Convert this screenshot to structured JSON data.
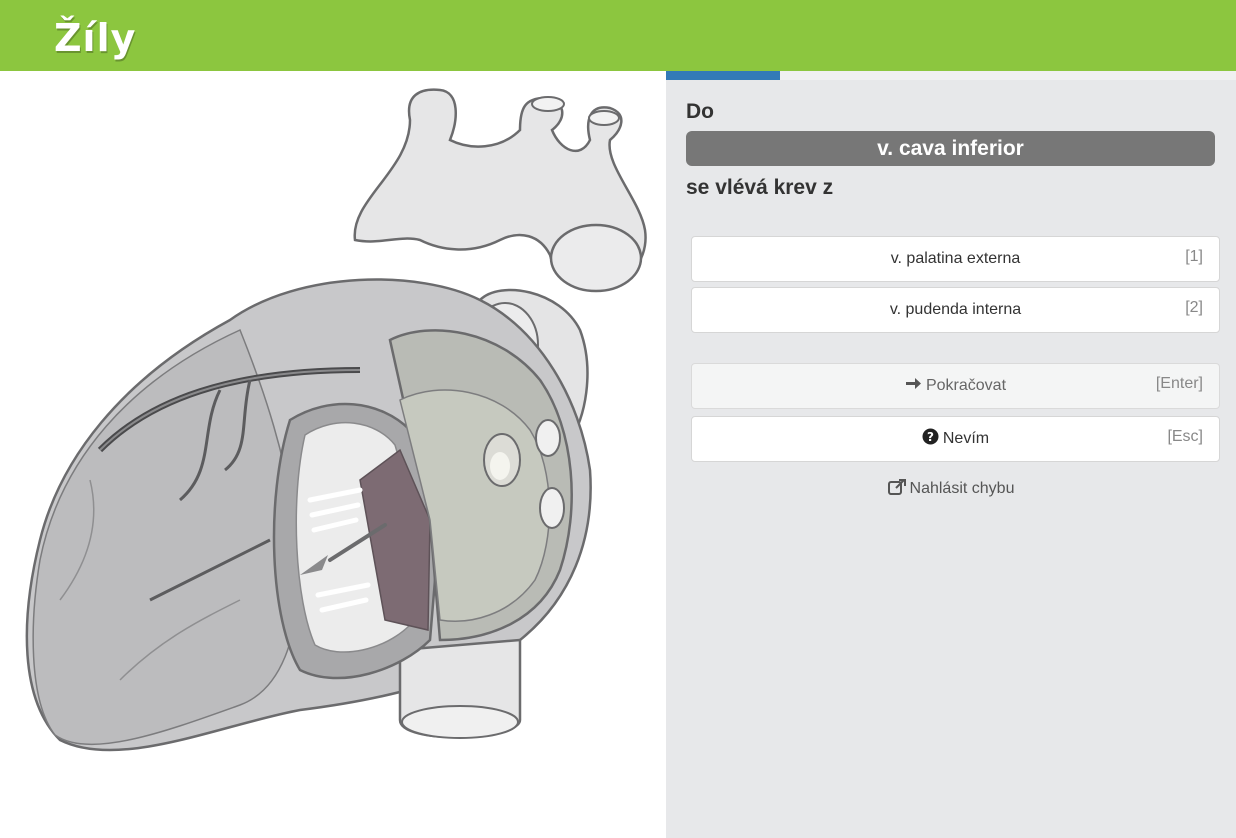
{
  "header": {
    "logo_text": "Žíly"
  },
  "progress": {
    "fraction": 0.2
  },
  "question": {
    "prefix": "Do",
    "term": "v. cava inferior",
    "suffix": "se vlévá krev z"
  },
  "options": [
    {
      "label": "v. palatina externa",
      "shortcut": "[1]"
    },
    {
      "label": "v. pudenda interna",
      "shortcut": "[2]"
    }
  ],
  "actions": {
    "continue_label": "Pokračovat",
    "continue_shortcut": "[Enter]",
    "continue_icon": "arrow-right-icon",
    "dont_know_label": "Nevím",
    "dont_know_shortcut": "[Esc]",
    "dont_know_icon": "question-circle-icon",
    "report_label": "Nahlásit chybu",
    "report_icon": "external-link-icon"
  },
  "colors": {
    "header_bg": "#8cc63f",
    "progress_fill": "#337ab7",
    "term_bg": "#777777",
    "panel_bg": "#e7e8ea"
  }
}
